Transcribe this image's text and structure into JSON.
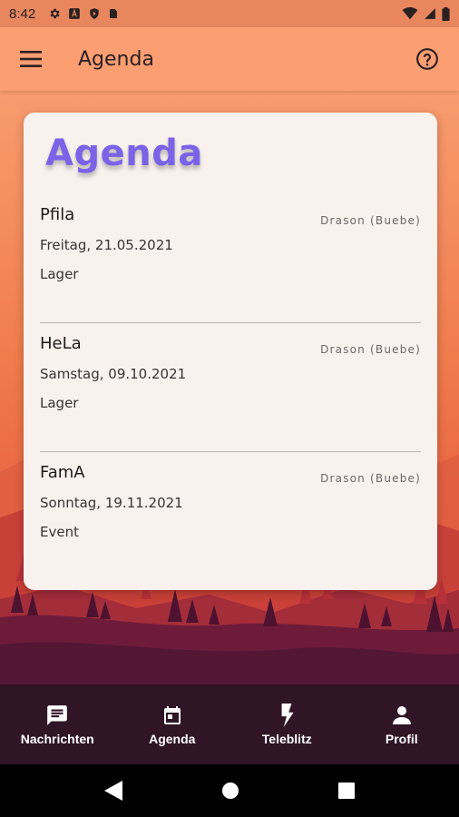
{
  "status_bar": {
    "time": "8:42"
  },
  "app_bar": {
    "title": "Agenda"
  },
  "card": {
    "title": "Agenda",
    "items": [
      {
        "name": "Pfila",
        "date": "Freitag, 21.05.2021",
        "type": "Lager",
        "group": "Drason (Buebe)"
      },
      {
        "name": "HeLa",
        "date": "Samstag, 09.10.2021",
        "type": "Lager",
        "group": "Drason (Buebe)"
      },
      {
        "name": "FamA",
        "date": "Sonntag, 19.11.2021",
        "type": "Event",
        "group": "Drason (Buebe)"
      }
    ]
  },
  "bottom_nav": {
    "items": [
      {
        "label": "Nachrichten",
        "icon": "message-icon"
      },
      {
        "label": "Agenda",
        "icon": "calendar-icon"
      },
      {
        "label": "Teleblitz",
        "icon": "flash-icon"
      },
      {
        "label": "Profil",
        "icon": "person-icon"
      }
    ]
  },
  "colors": {
    "app_bar": "#fb9e71",
    "card_title": "#7a63e8",
    "nav_bg": "#2f1526"
  }
}
